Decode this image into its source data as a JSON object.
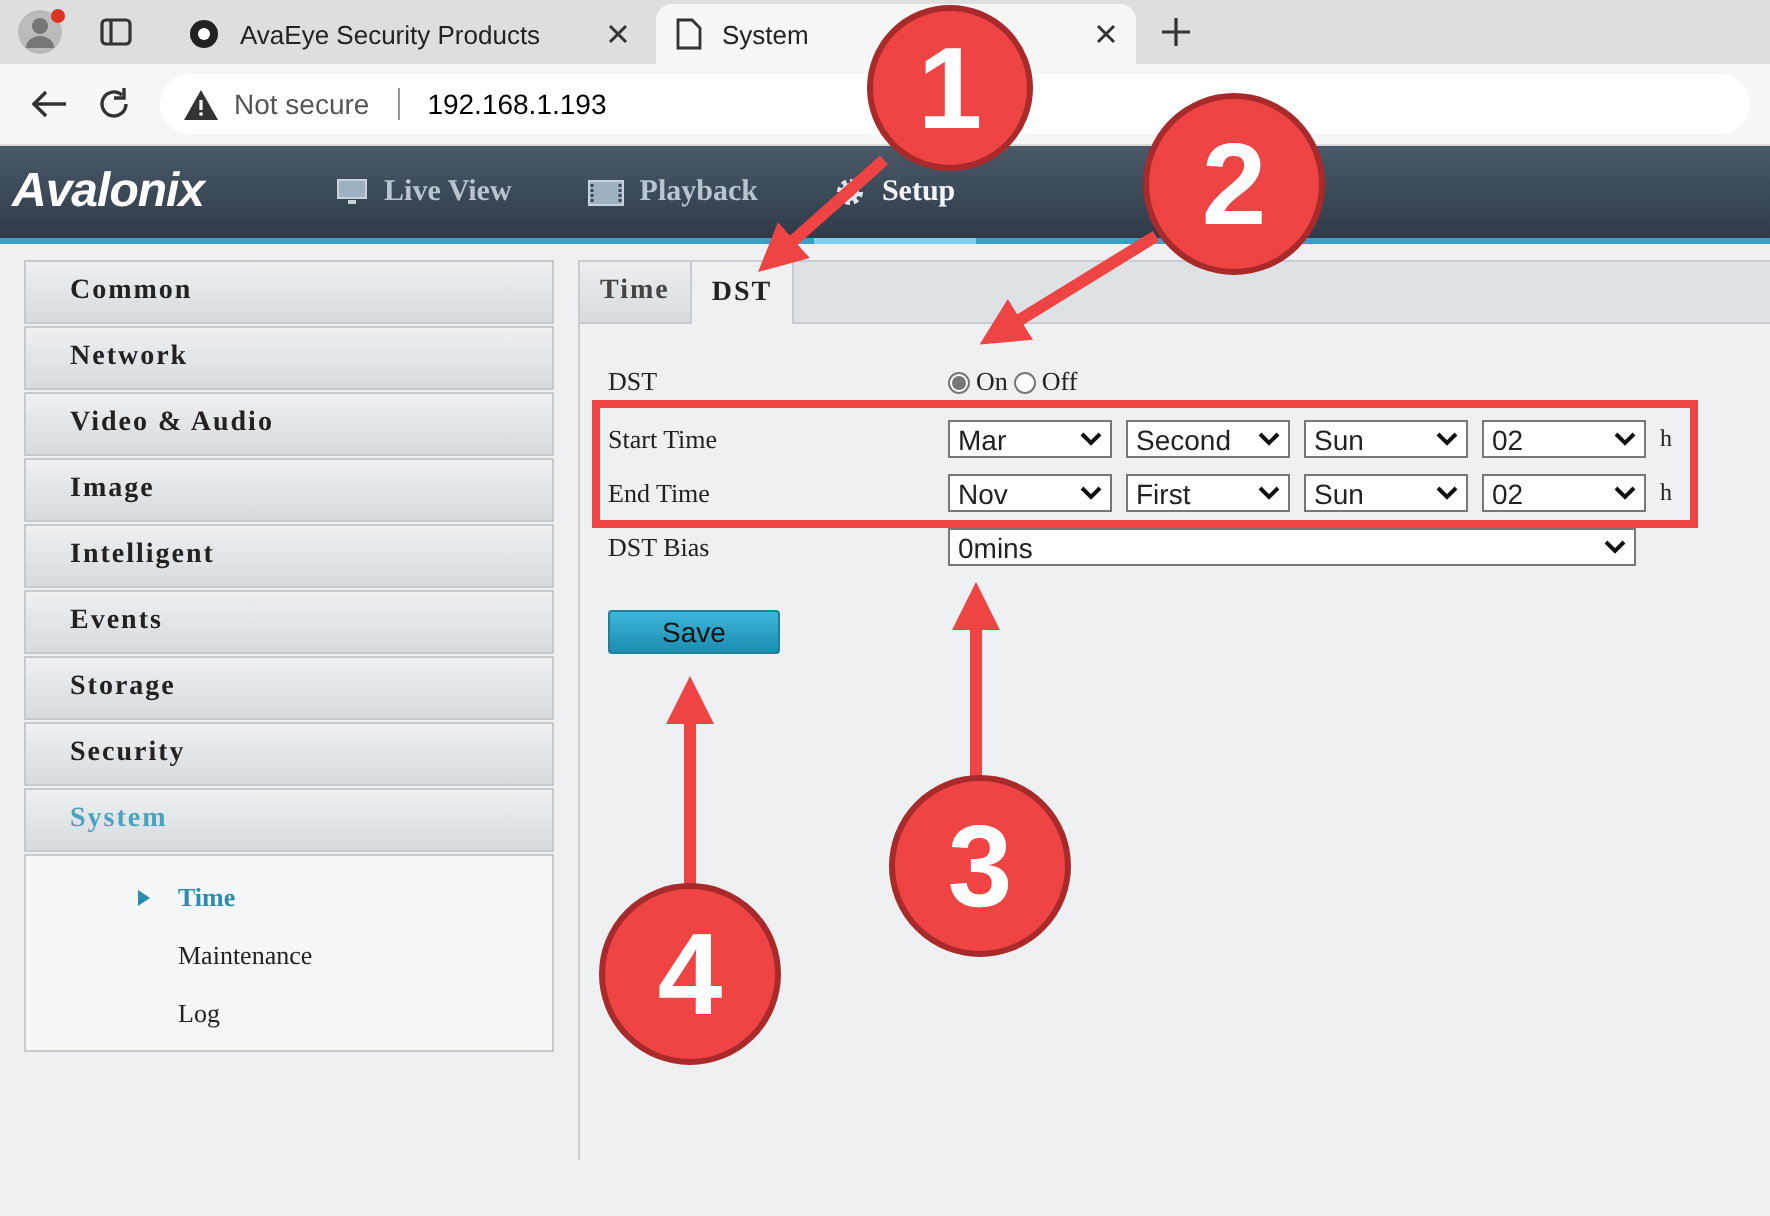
{
  "browser": {
    "tabs": [
      {
        "title": "AvaEye Security Products",
        "selected": false
      },
      {
        "title": "System",
        "selected": true
      }
    ],
    "address": {
      "warning": "Not secure",
      "url": "192.168.1.193"
    }
  },
  "header": {
    "logo": "Avalonix",
    "nav": [
      {
        "label": "Live View",
        "selected": false,
        "kind": "monitor"
      },
      {
        "label": "Playback",
        "selected": false,
        "kind": "film"
      },
      {
        "label": "Setup",
        "selected": true,
        "kind": "gear"
      }
    ]
  },
  "sidebar": {
    "items": [
      {
        "label": "Common",
        "selected": false
      },
      {
        "label": "Network",
        "selected": false
      },
      {
        "label": "Video & Audio",
        "selected": false
      },
      {
        "label": "Image",
        "selected": false
      },
      {
        "label": "Intelligent",
        "selected": false
      },
      {
        "label": "Events",
        "selected": false
      },
      {
        "label": "Storage",
        "selected": false
      },
      {
        "label": "Security",
        "selected": false
      },
      {
        "label": "System",
        "selected": true,
        "children": [
          {
            "label": "Time",
            "selected": true
          },
          {
            "label": "Maintenance",
            "selected": false
          },
          {
            "label": "Log",
            "selected": false
          }
        ]
      }
    ]
  },
  "tabs": [
    {
      "label": "Time",
      "selected": false
    },
    {
      "label": "DST",
      "selected": true
    }
  ],
  "form": {
    "dst": {
      "label": "DST",
      "options": [
        {
          "label": "On",
          "selected": true
        },
        {
          "label": "Off",
          "selected": false
        }
      ]
    },
    "rows": [
      {
        "label": "Start Time",
        "values": [
          "Mar",
          "Second",
          "Sun",
          "02"
        ],
        "unit": "h"
      },
      {
        "label": "End Time",
        "values": [
          "Nov",
          "First",
          "Sun",
          "02"
        ],
        "unit": "h"
      }
    ],
    "bias": {
      "label": "DST Bias",
      "value": "0mins"
    },
    "save": "Save"
  },
  "annotations": {
    "steps": [
      "1",
      "2",
      "3",
      "4"
    ]
  }
}
